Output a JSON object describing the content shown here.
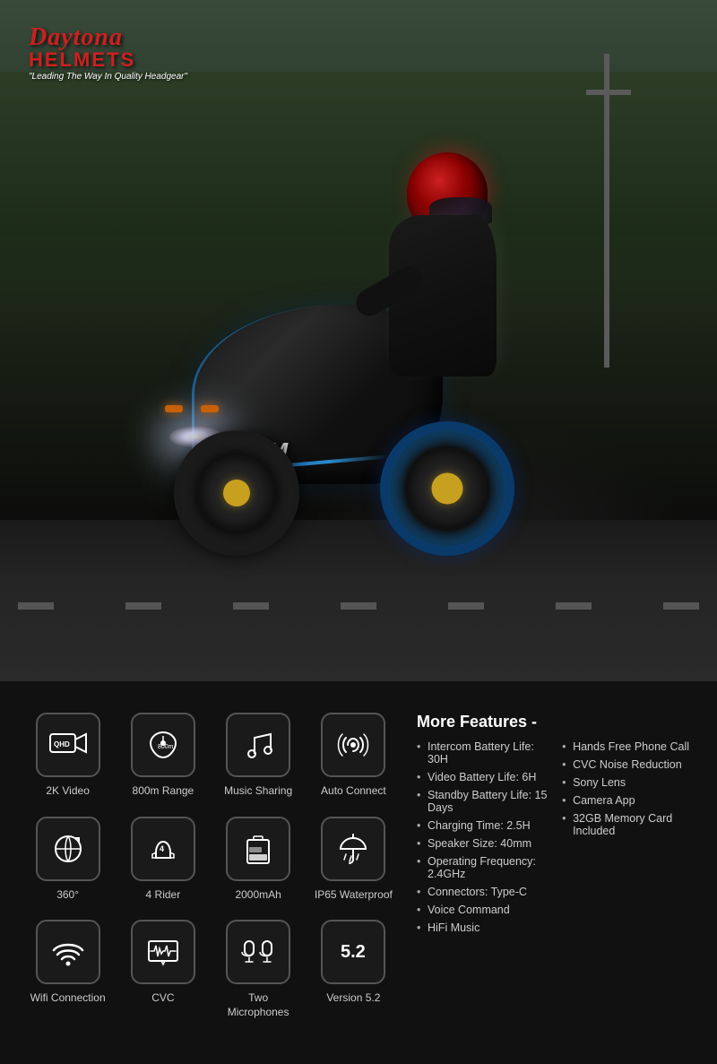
{
  "logo": {
    "brand": "Daytona",
    "sub": "HELMETS",
    "tagline": "\"Leading The Way In Quality Headgear\""
  },
  "features": [
    {
      "id": "2k-video",
      "label": "2K Video",
      "icon": "video"
    },
    {
      "id": "800m-range",
      "label": "800m Range",
      "icon": "range"
    },
    {
      "id": "music-sharing",
      "label": "Music Sharing",
      "icon": "music"
    },
    {
      "id": "auto-connect",
      "label": "Auto Connect",
      "icon": "link"
    },
    {
      "id": "360",
      "label": "360°",
      "icon": "rotate"
    },
    {
      "id": "4-rider",
      "label": "4 Rider",
      "icon": "rider"
    },
    {
      "id": "2000mah",
      "label": "2000mAh",
      "icon": "battery"
    },
    {
      "id": "ip65",
      "label": "IP65 Waterproof",
      "icon": "water"
    },
    {
      "id": "wifi",
      "label": "Wifi Connection",
      "icon": "wifi"
    },
    {
      "id": "cvc",
      "label": "CVC",
      "icon": "cvc"
    },
    {
      "id": "two-mic",
      "label": "Two Microphones",
      "icon": "mic"
    },
    {
      "id": "v52",
      "label": "Version 5.2",
      "icon": "bluetooth"
    }
  ],
  "more_features": {
    "title": "More Features -",
    "left_list": [
      "Intercom Battery Life: 30H",
      "Video Battery Life: 6H",
      "Standby Battery Life: 15 Days",
      "Charging Time: 2.5H",
      "Speaker Size: 40mm",
      "Operating Frequency: 2.4GHz",
      "Connectors: Type-C",
      "Voice Command",
      "HiFi Music"
    ],
    "right_list": [
      "Hands Free Phone Call",
      "CVC Noise Reduction",
      "Sony Lens",
      "Camera App",
      "32GB Memory Card Included"
    ]
  }
}
